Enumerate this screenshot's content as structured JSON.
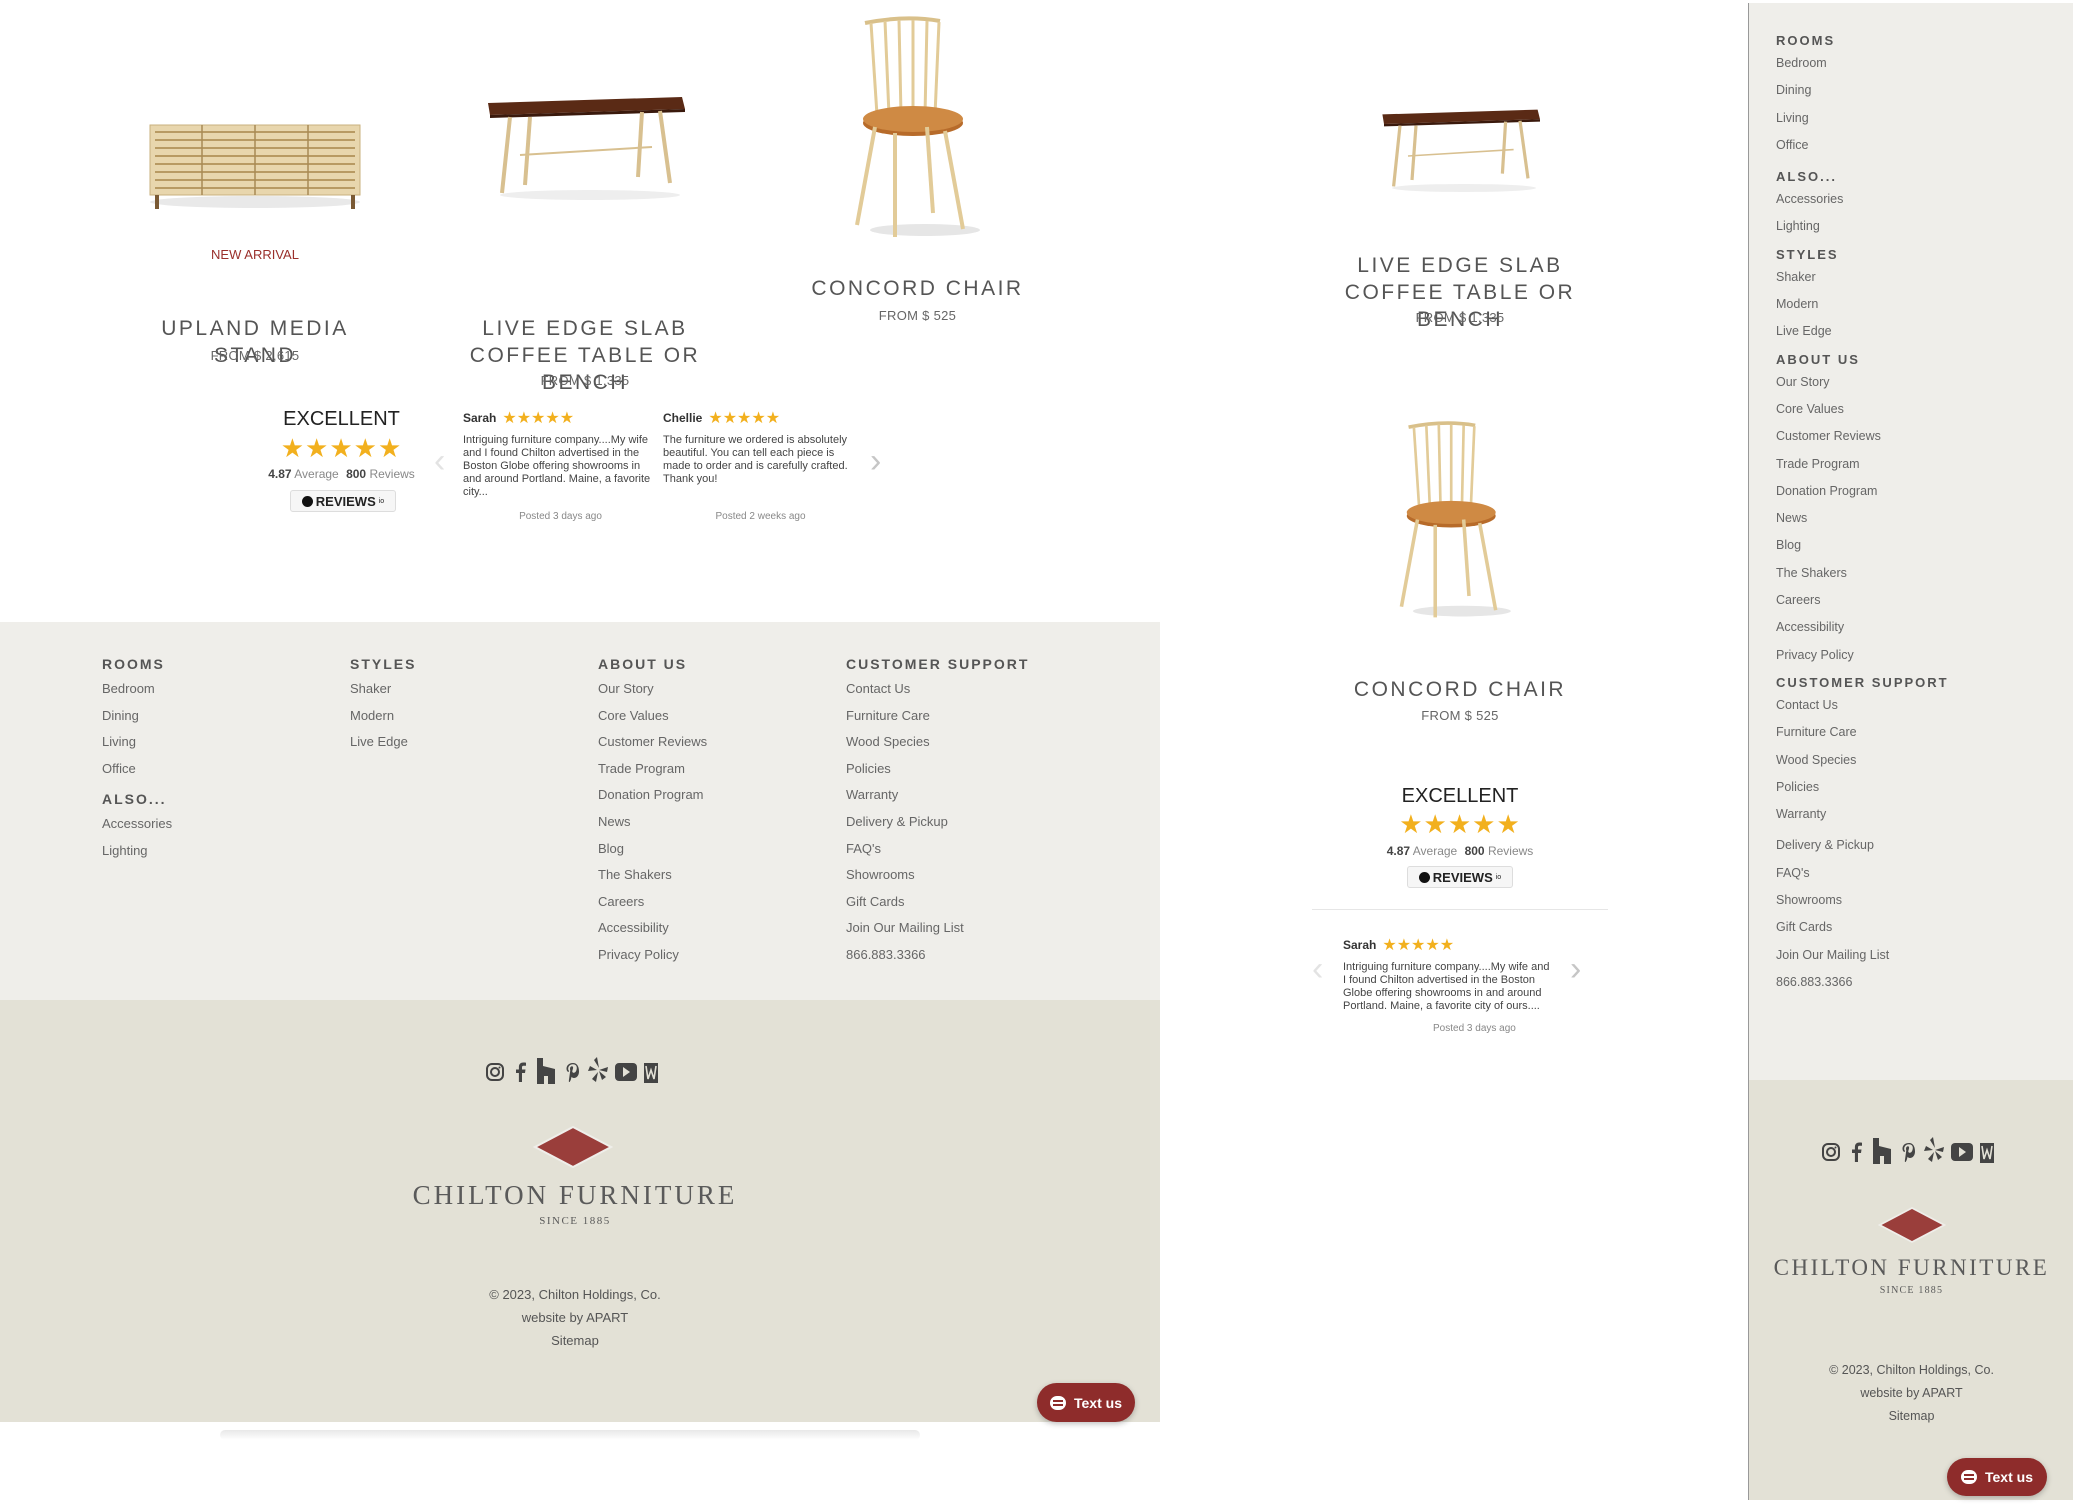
{
  "products_left": [
    {
      "badge": "NEW ARRIVAL",
      "title": "UPLAND MEDIA STAND",
      "price": "FROM $ 2,615"
    },
    {
      "badge": "",
      "title": "LIVE EDGE SLAB COFFEE TABLE OR BENCH",
      "price": "FROM $ 1,335"
    },
    {
      "badge": "",
      "title": "CONCORD CHAIR",
      "price": "FROM $ 525"
    }
  ],
  "reviews_widget": {
    "rating_word": "EXCELLENT",
    "stars": "★★★★★",
    "average": "4.87",
    "average_label": "Average",
    "count": "800",
    "count_label": "Reviews",
    "badge": "REVIEWS",
    "badge_suffix": "io",
    "reviews": [
      {
        "name": "Sarah",
        "stars": "★★★★★",
        "text": "Intriguing furniture company....My wife and I found Chilton advertised in the Boston Globe offering showrooms in and around Portland. Maine, a favorite city...",
        "posted": "Posted 3 days ago"
      },
      {
        "name": "Chellie",
        "stars": "★★★★★",
        "text": "The furniture we ordered is absolutely beautiful. You can tell each piece is made to order and is carefully crafted. Thank you!",
        "posted": "Posted 2 weeks ago"
      }
    ],
    "prev_icon": "chevron-left-icon",
    "next_icon": "chevron-right-icon"
  },
  "footer": {
    "rooms": {
      "heading": "ROOMS",
      "items": [
        "Bedroom",
        "Dining",
        "Living",
        "Office"
      ]
    },
    "also": {
      "heading": "ALSO...",
      "items": [
        "Accessories",
        "Lighting"
      ]
    },
    "styles": {
      "heading": "STYLES",
      "items": [
        "Shaker",
        "Modern",
        "Live Edge"
      ]
    },
    "about": {
      "heading": "ABOUT US",
      "items": [
        "Our Story",
        "Core Values",
        "Customer Reviews",
        "Trade Program",
        "Donation Program",
        "News",
        "Blog",
        "The Shakers",
        "Careers",
        "Accessibility",
        "Privacy Policy"
      ]
    },
    "support": {
      "heading": "CUSTOMER SUPPORT",
      "items": [
        "Contact Us",
        "Furniture Care",
        "Wood Species",
        "Policies",
        "Warranty",
        "Delivery & Pickup",
        "FAQ's",
        "Showrooms",
        "Gift Cards",
        "Join Our Mailing List",
        "866.883.3366"
      ]
    },
    "social_icons": [
      "instagram-icon",
      "facebook-icon",
      "houzz-icon",
      "pinterest-icon",
      "yelp-icon",
      "youtube-icon",
      "wayfair-icon"
    ],
    "brand": "CHILTON FURNITURE",
    "since": "SINCE 1885",
    "copyright": "© 2023, Chilton Holdings, Co.",
    "credit": "website by APART",
    "sitemap": "Sitemap",
    "text_us": "Text us"
  },
  "products_right": [
    {
      "title": "LIVE EDGE SLAB COFFEE TABLE OR BENCH",
      "price": "FROM $ 1,335"
    },
    {
      "title": "CONCORD CHAIR",
      "price": "FROM $ 525"
    }
  ],
  "reviews_right": {
    "name": "Sarah",
    "text": "Intriguing furniture company....My wife and I found Chilton advertised in the Boston Globe offering showrooms in and around Portland. Maine, a favorite city of ours....",
    "posted": "Posted 3 days ago"
  },
  "colors": {
    "accent": "#9a2f2b",
    "footer_light": "#efeeea",
    "footer_dark": "#e3e1d6",
    "star": "#f2b01e"
  }
}
